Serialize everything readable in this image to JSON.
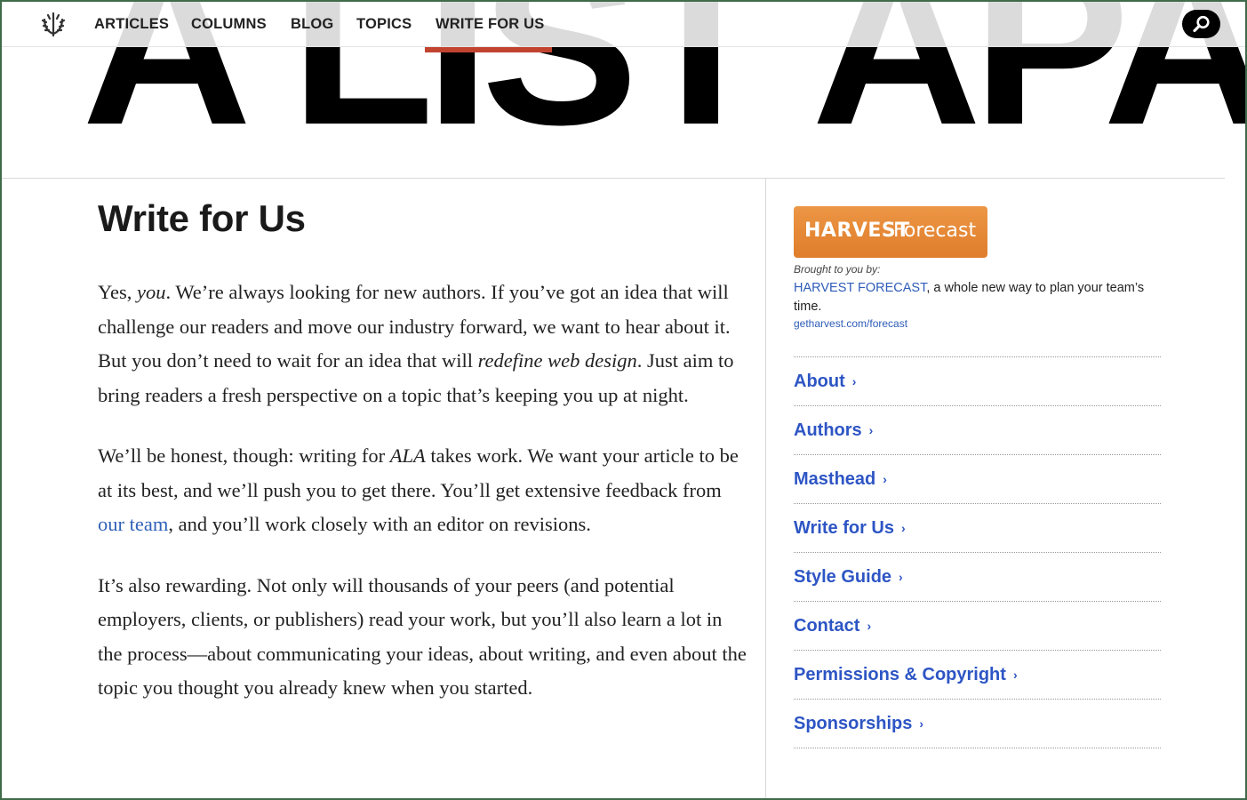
{
  "site": {
    "logo_text": "A LIST APART",
    "nav": [
      {
        "label": "ARTICLES"
      },
      {
        "label": "COLUMNS"
      },
      {
        "label": "BLOG"
      },
      {
        "label": "TOPICS"
      },
      {
        "label": "WRITE FOR US",
        "active": true
      }
    ],
    "accent_color": "#c2442f",
    "link_color": "#2d55c4"
  },
  "main": {
    "title": "Write for Us",
    "p1": {
      "t1": "Yes, ",
      "em1": "you",
      "t2": ". We’re always looking for new authors. If you’ve got an idea that will challenge our readers and move our industry forward, we want to hear about it. But you don’t need to wait for an idea that will ",
      "em2": "redefine web design",
      "t3": ". Just aim to bring readers a fresh perspective on a topic that’s keeping you up at night."
    },
    "p2": {
      "t1": "We’ll be honest, though: writing for ",
      "em1": "ALA",
      "t2": " takes work. We want your article to be at its best, and we’ll push you to get there. You’ll get extensive feedback from ",
      "link": "our team",
      "t3": ", and you’ll work closely with an editor on revisions."
    },
    "p3": "It’s also rewarding. Not only will thousands of your peers (and potential employers, clients, or publishers) read your work, but you’ll also learn a lot in the process—about communicating your ideas, about writing, and even about the topic you thought you already knew when you started."
  },
  "sidebar": {
    "sponsor": {
      "brand": "HARVEST",
      "product": "Forecast",
      "brought_by": "Brought to you by:",
      "name": "HARVEST FORECAST",
      "tagline": ", a whole new way to plan your team’s time.",
      "url": "getharvest.com/forecast",
      "color": "#e98b3a"
    },
    "links": [
      {
        "label": "About",
        "chevron": "›"
      },
      {
        "label": "Authors",
        "chevron": "›"
      },
      {
        "label": "Masthead",
        "chevron": "›"
      },
      {
        "label": "Write for Us",
        "chevron": "›"
      },
      {
        "label": "Style Guide",
        "chevron": "›"
      },
      {
        "label": "Contact",
        "chevron": "›"
      },
      {
        "label": "Permissions & Copyright",
        "chevron": "›"
      },
      {
        "label": "Sponsorships",
        "chevron": "›"
      }
    ]
  }
}
